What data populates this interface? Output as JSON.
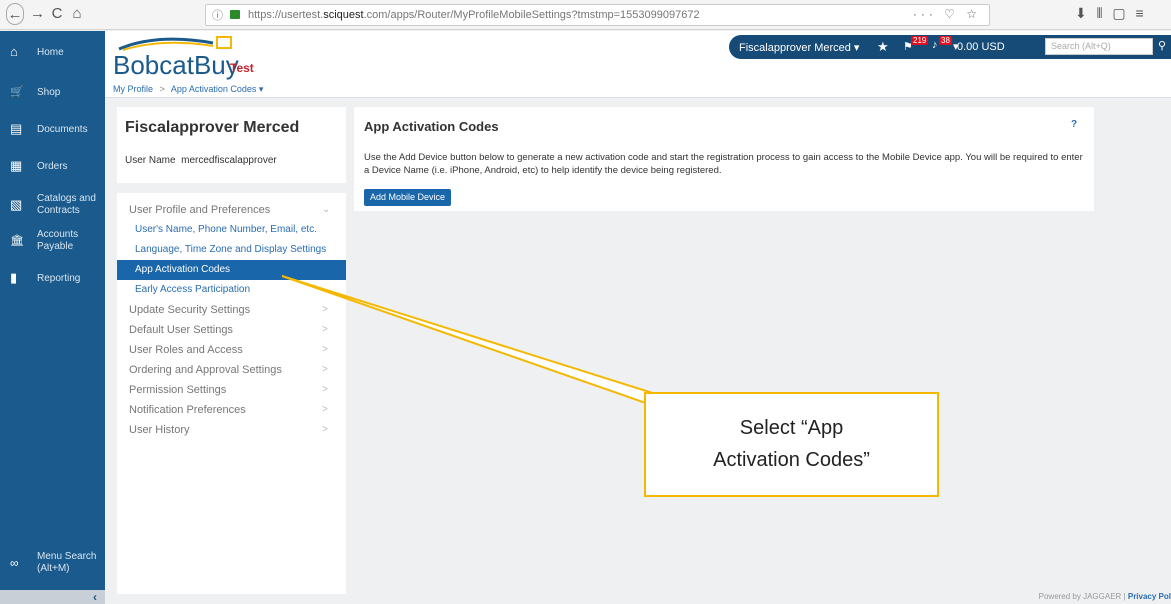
{
  "browser": {
    "back": "←",
    "forward": "→",
    "reload": "C",
    "home": "⌂",
    "info": "ⓘ",
    "url_prefix": "https://usertest.",
    "url_domain": "sciquest",
    "url_suffix": ".com/apps/Router/MyProfileMobileSettings?tmstmp=1553099097672",
    "url_actions": "··· ♡ ☆",
    "toolbar_right": "⬇  ⫴  ▢  ≡"
  },
  "sidebar": {
    "items": [
      {
        "icon": "home-icon",
        "glyph": "⌂",
        "label": "Home"
      },
      {
        "icon": "cart-icon",
        "glyph": "🛒",
        "label": "Shop"
      },
      {
        "icon": "documents-icon",
        "glyph": "▤",
        "label": "Documents"
      },
      {
        "icon": "orders-icon",
        "glyph": "▦",
        "label": "Orders"
      },
      {
        "icon": "catalogs-icon",
        "glyph": "▧",
        "label": "Catalogs and Contracts"
      },
      {
        "icon": "bank-icon",
        "glyph": "🏛",
        "label": "Accounts Payable"
      },
      {
        "icon": "reporting-icon",
        "glyph": "▮",
        "label": "Reporting"
      }
    ],
    "menu_search": "Menu Search",
    "menu_search_shortcut": "(Alt+M)",
    "collapse": "‹"
  },
  "header": {
    "logo": "BobcatBuy",
    "logo_tag": "Test",
    "user_name": "Fiscalapprover Merced ▾",
    "flag_count": "219",
    "bell_count": "38",
    "cart_total": "0.00 USD",
    "search_placeholder": "Search (Alt+Q)"
  },
  "breadcrumb": {
    "root": "My Profile",
    "separator": ">",
    "current": "App Activation Codes ▾"
  },
  "profile": {
    "name": "Fiscalapprover Merced",
    "user_name_label": "User Name",
    "user_name_value": "mercedfiscalapprover",
    "menu": [
      {
        "label": "User Profile and Preferences",
        "chevron": "⌄"
      },
      {
        "label": "Update Security Settings",
        "chevron": ">"
      },
      {
        "label": "Default User Settings",
        "chevron": ">"
      },
      {
        "label": "User Roles and Access",
        "chevron": ">"
      },
      {
        "label": "Ordering and Approval Settings",
        "chevron": ">"
      },
      {
        "label": "Permission Settings",
        "chevron": ">"
      },
      {
        "label": "Notification Preferences",
        "chevron": ">"
      },
      {
        "label": "User History",
        "chevron": ">"
      }
    ],
    "submenu": [
      "User's Name, Phone Number, Email, etc.",
      "Language, Time Zone and Display Settings",
      "App Activation Codes",
      "Early Access Participation"
    ]
  },
  "main": {
    "title": "App Activation Codes",
    "help": "?",
    "body": "Use the Add Device button below to generate a new activation code and start the registration process to gain access to the Mobile Device app. You will be required to enter a Device Name (i.e. iPhone, Android, etc) to help identify the device being registered.",
    "add_button": "Add Mobile Device"
  },
  "footer": {
    "powered": "Powered by JAGGAER | ",
    "privacy": "Privacy Pol"
  },
  "callout": {
    "line1": "Select “App",
    "line2": "Activation Codes”",
    "border_color": "#f5b800"
  }
}
